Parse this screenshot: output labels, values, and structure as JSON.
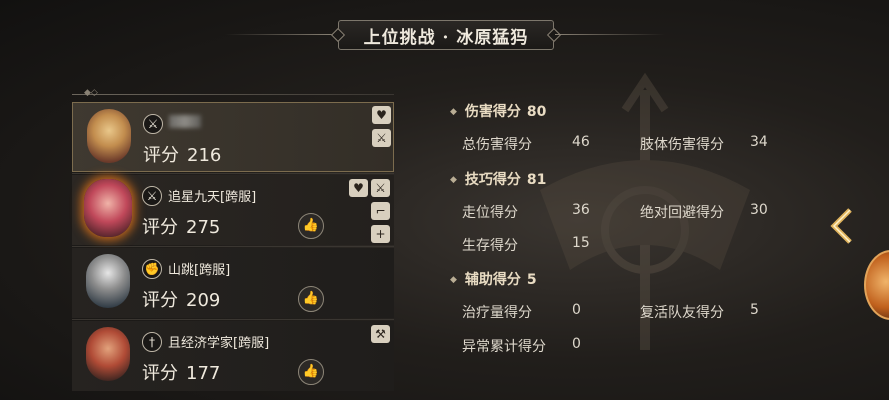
{
  "title": "上位挑战 · 冰原猛犸",
  "players": [
    {
      "name": "",
      "score_label": "评分",
      "score": "216",
      "class_icon": "crossed-swords-icon",
      "tags": [
        "heart-icon",
        "crossed-swords-icon"
      ],
      "like": false
    },
    {
      "name": "追星九天[跨服]",
      "score_label": "评分",
      "score": "275",
      "class_icon": "crossed-swords-icon",
      "tags": [
        "heart-icon",
        "crossed-swords-icon",
        "boot-icon",
        "plus-icon"
      ],
      "like": true
    },
    {
      "name": "山跳[跨服]",
      "score_label": "评分",
      "score": "209",
      "class_icon": "gauntlet-icon",
      "tags": [],
      "like": true
    },
    {
      "name": "且经济学家[跨服]",
      "score_label": "评分",
      "score": "177",
      "class_icon": "sword-icon",
      "tags": [
        "hammer-icon"
      ],
      "like": true
    }
  ],
  "stats": {
    "damage": {
      "title": "伤害得分",
      "value": "80",
      "items": [
        {
          "label": "总伤害得分",
          "value": "46"
        },
        {
          "label": "肢体伤害得分",
          "value": "34"
        }
      ]
    },
    "skill": {
      "title": "技巧得分",
      "value": "81",
      "items": [
        {
          "label": "走位得分",
          "value": "36"
        },
        {
          "label": "绝对回避得分",
          "value": "30"
        },
        {
          "label": "生存得分",
          "value": "15"
        }
      ]
    },
    "support": {
      "title": "辅助得分",
      "value": "5",
      "items": [
        {
          "label": "治疗量得分",
          "value": "0"
        },
        {
          "label": "复活队友得分",
          "value": "5"
        },
        {
          "label": "异常累计得分",
          "value": "0"
        }
      ]
    }
  },
  "colors": {
    "accent_glow": "#c86a1c",
    "selected_border": "#7c6c4e",
    "text": "#e8e2d6"
  }
}
